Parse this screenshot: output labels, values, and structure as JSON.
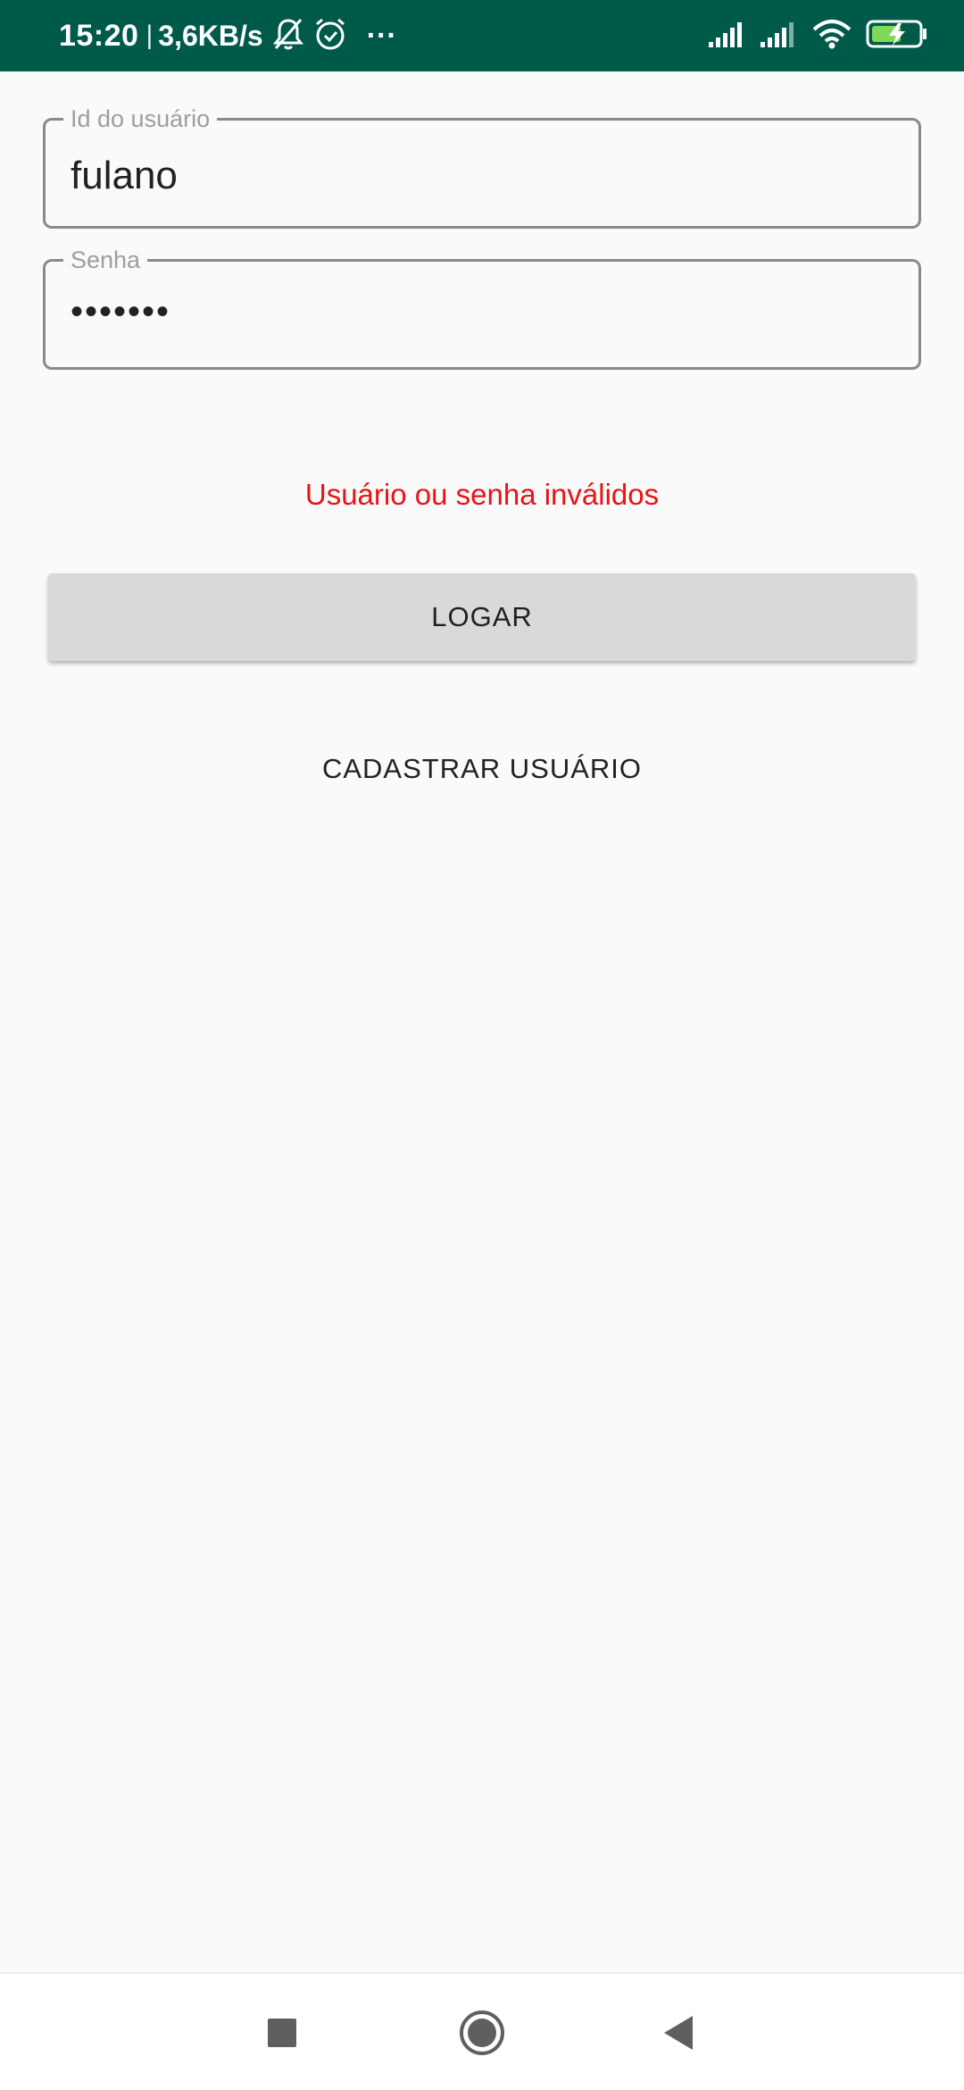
{
  "status_bar": {
    "time": "15:20",
    "separator": "|",
    "network_speed": "3,6KB/s",
    "more_indicator": "···",
    "icons": [
      "bell-off-icon",
      "alarm-icon",
      "signal-icon",
      "signal-icon",
      "wifi-icon",
      "battery-charging-icon"
    ],
    "background_color": "#005a4a"
  },
  "form": {
    "user_id": {
      "label": "Id do usuário",
      "value": "fulano"
    },
    "password": {
      "label": "Senha",
      "value": "•••••••"
    },
    "error_message": "Usuário ou senha inválidos",
    "error_color": "#e81414",
    "login_button": "LOGAR",
    "register_button": "CADASTRAR USUÁRIO"
  },
  "nav_bar": {
    "buttons": [
      "recents-square-icon",
      "home-circle-icon",
      "back-triangle-icon"
    ]
  }
}
